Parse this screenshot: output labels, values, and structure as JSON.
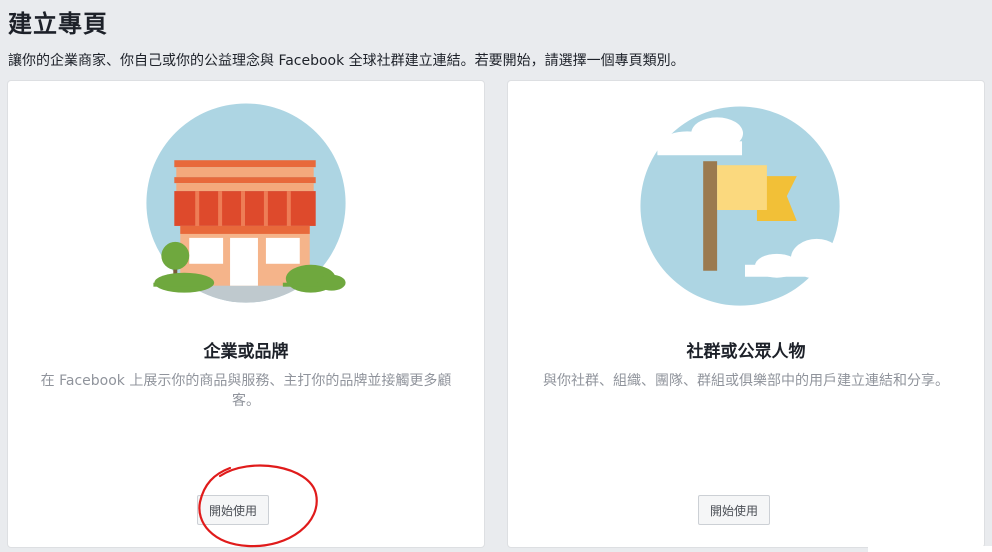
{
  "header": {
    "title": "建立專頁",
    "subtitle": "讓你的企業商家、你自己或你的公益理念與 Facebook 全球社群建立連結。若要開始，請選擇一個專頁類別。"
  },
  "cards": [
    {
      "title": "企業或品牌",
      "description": "在 Facebook 上展示你的商品與服務、主打你的品牌並接觸更多顧客。",
      "button_label": "開始使用",
      "icon": "storefront-illustration"
    },
    {
      "title": "社群或公眾人物",
      "description": "與你社群、組織、團隊、群組或俱樂部中的用戶建立連結和分享。",
      "button_label": "開始使用",
      "icon": "flag-illustration"
    }
  ],
  "colors": {
    "background": "#e9ebee",
    "card_bg": "#ffffff",
    "circle_blue": "#add5e3",
    "annotation_red": "#e01b1b"
  }
}
